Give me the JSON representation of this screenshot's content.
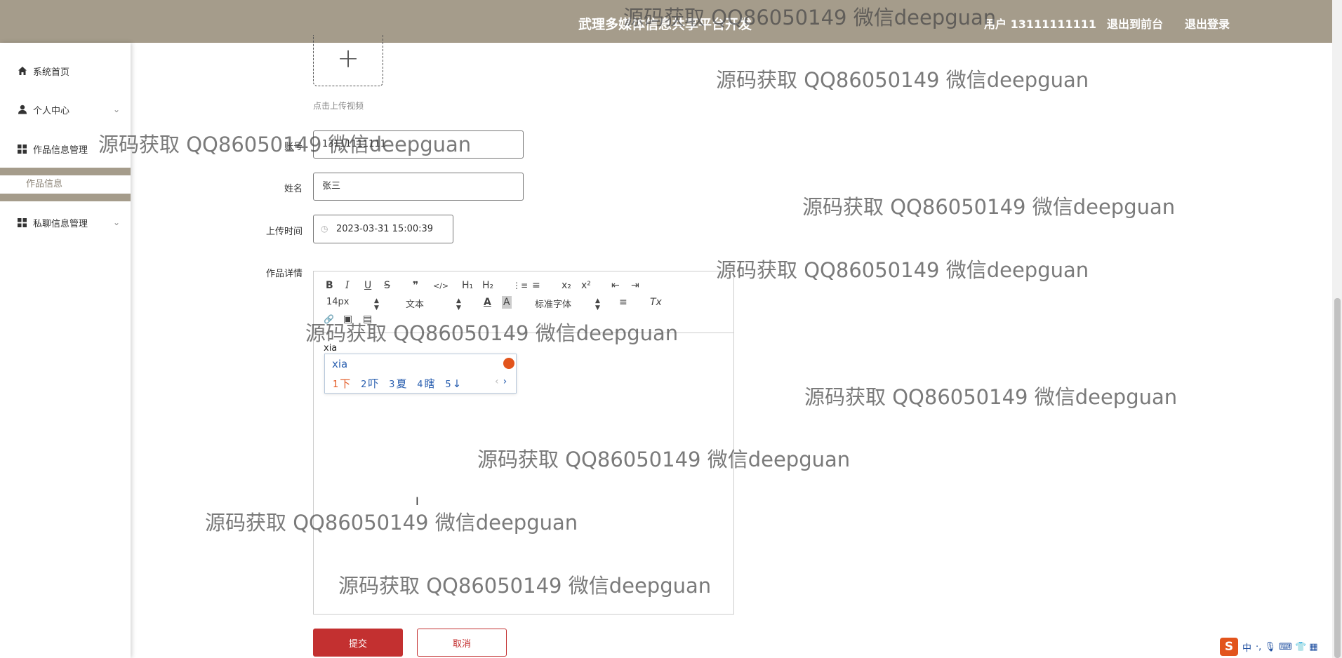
{
  "header": {
    "title": "武理多媒体信息共享平台开发",
    "user_label": "用户 13111111111",
    "back_front_label": "退出到前台",
    "logout_label": "退出登录"
  },
  "sidebar": {
    "items": [
      {
        "label": "系统首页",
        "icon": "home-icon"
      },
      {
        "label": "个人中心",
        "icon": "user-icon"
      },
      {
        "label": "作品信息管理",
        "icon": "grid-icon"
      },
      {
        "label": "私聊信息管理",
        "icon": "grid-icon"
      }
    ],
    "sub_item": "作品信息",
    "chevron": "⌄"
  },
  "form": {
    "upload_hint": "点击上传视频",
    "upload_plus": "+",
    "account_label": "账号",
    "account_value": "13111111111",
    "name_label": "姓名",
    "name_value": "张三",
    "time_label": "上传时间",
    "time_value": "2023-03-31 15:00:39",
    "detail_label": "作品详情",
    "submit_label": "提交",
    "cancel_label": "取消"
  },
  "editor": {
    "font_size": "14px",
    "block_type": "文本",
    "font_family": "标准字体",
    "typed_text": "xia",
    "buttons": {
      "bold": "B",
      "italic": "I",
      "underline": "U",
      "strike": "S",
      "quote": "❞",
      "code": "</>",
      "h1": "H₁",
      "h2": "H₂",
      "ol": "⋮≡",
      "ul": "≡",
      "sub": "x₂",
      "sup": "x²",
      "outdent": "⇤",
      "indent": "⇥",
      "color": "A",
      "bg": "A",
      "align": "≡",
      "clean": "Tx",
      "link": "🔗",
      "image": "▣",
      "video": "▤"
    }
  },
  "ime": {
    "pinyin": "xia",
    "candidates": [
      {
        "num": "1",
        "text": "下"
      },
      {
        "num": "2",
        "text": "吓"
      },
      {
        "num": "3",
        "text": "夏"
      },
      {
        "num": "4",
        "text": "瞎"
      },
      {
        "num": "5",
        "text": "↓"
      }
    ],
    "prev": "‹",
    "next": "›"
  },
  "watermark_text": "源码获取 QQ86050149 微信deepguan",
  "tray": {
    "logo": "S",
    "lang": "中",
    "icons": "·, 🎙 ⌨ 👕 ▦"
  }
}
